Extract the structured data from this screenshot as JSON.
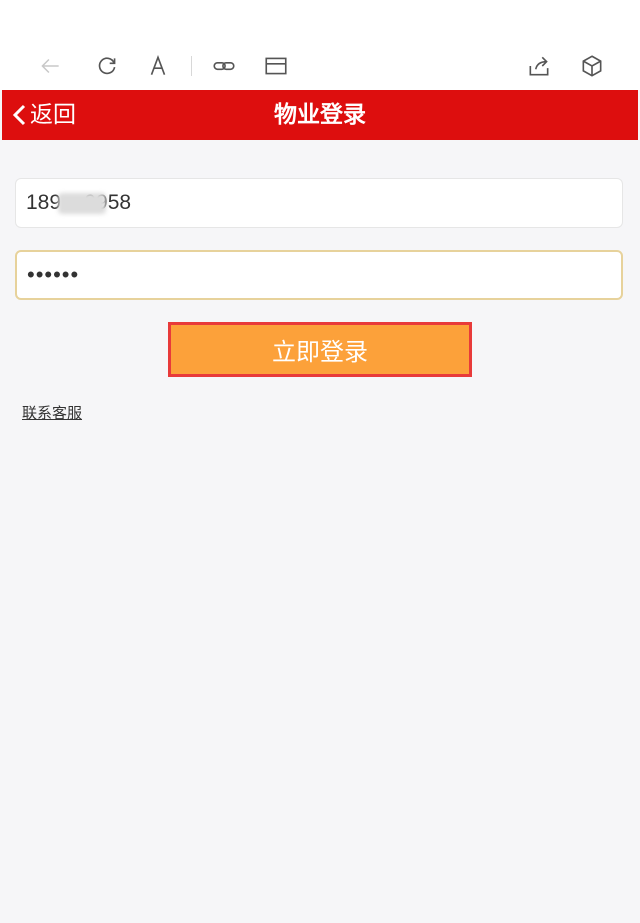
{
  "header": {
    "back_label": "返回",
    "title": "物业登录"
  },
  "form": {
    "phone_value": "189    9958",
    "password_value": "••••••",
    "login_label": "立即登录"
  },
  "links": {
    "customer_service": "联系客服"
  },
  "colors": {
    "header_bg": "#dd0e0e",
    "button_bg": "#fca13a",
    "button_border": "#e83a3a"
  }
}
